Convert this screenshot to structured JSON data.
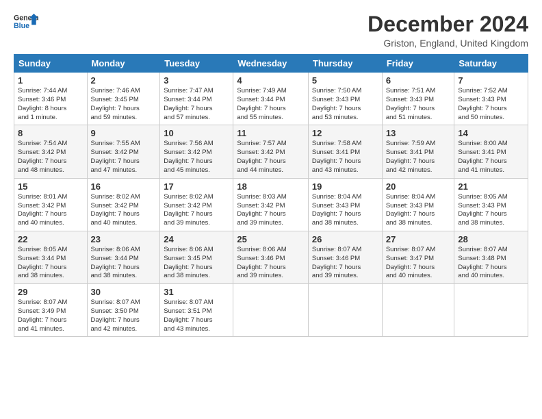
{
  "logo": {
    "line1": "General",
    "line2": "Blue"
  },
  "title": "December 2024",
  "subtitle": "Griston, England, United Kingdom",
  "headers": [
    "Sunday",
    "Monday",
    "Tuesday",
    "Wednesday",
    "Thursday",
    "Friday",
    "Saturday"
  ],
  "weeks": [
    [
      {
        "day": "1",
        "sunrise": "7:44 AM",
        "sunset": "3:46 PM",
        "daylight": "8 hours and 1 minute."
      },
      {
        "day": "2",
        "sunrise": "7:46 AM",
        "sunset": "3:45 PM",
        "daylight": "7 hours and 59 minutes."
      },
      {
        "day": "3",
        "sunrise": "7:47 AM",
        "sunset": "3:44 PM",
        "daylight": "7 hours and 57 minutes."
      },
      {
        "day": "4",
        "sunrise": "7:49 AM",
        "sunset": "3:44 PM",
        "daylight": "7 hours and 55 minutes."
      },
      {
        "day": "5",
        "sunrise": "7:50 AM",
        "sunset": "3:43 PM",
        "daylight": "7 hours and 53 minutes."
      },
      {
        "day": "6",
        "sunrise": "7:51 AM",
        "sunset": "3:43 PM",
        "daylight": "7 hours and 51 minutes."
      },
      {
        "day": "7",
        "sunrise": "7:52 AM",
        "sunset": "3:43 PM",
        "daylight": "7 hours and 50 minutes."
      }
    ],
    [
      {
        "day": "8",
        "sunrise": "7:54 AM",
        "sunset": "3:42 PM",
        "daylight": "7 hours and 48 minutes."
      },
      {
        "day": "9",
        "sunrise": "7:55 AM",
        "sunset": "3:42 PM",
        "daylight": "7 hours and 47 minutes."
      },
      {
        "day": "10",
        "sunrise": "7:56 AM",
        "sunset": "3:42 PM",
        "daylight": "7 hours and 45 minutes."
      },
      {
        "day": "11",
        "sunrise": "7:57 AM",
        "sunset": "3:42 PM",
        "daylight": "7 hours and 44 minutes."
      },
      {
        "day": "12",
        "sunrise": "7:58 AM",
        "sunset": "3:41 PM",
        "daylight": "7 hours and 43 minutes."
      },
      {
        "day": "13",
        "sunrise": "7:59 AM",
        "sunset": "3:41 PM",
        "daylight": "7 hours and 42 minutes."
      },
      {
        "day": "14",
        "sunrise": "8:00 AM",
        "sunset": "3:41 PM",
        "daylight": "7 hours and 41 minutes."
      }
    ],
    [
      {
        "day": "15",
        "sunrise": "8:01 AM",
        "sunset": "3:42 PM",
        "daylight": "7 hours and 40 minutes."
      },
      {
        "day": "16",
        "sunrise": "8:02 AM",
        "sunset": "3:42 PM",
        "daylight": "7 hours and 40 minutes."
      },
      {
        "day": "17",
        "sunrise": "8:02 AM",
        "sunset": "3:42 PM",
        "daylight": "7 hours and 39 minutes."
      },
      {
        "day": "18",
        "sunrise": "8:03 AM",
        "sunset": "3:42 PM",
        "daylight": "7 hours and 39 minutes."
      },
      {
        "day": "19",
        "sunrise": "8:04 AM",
        "sunset": "3:43 PM",
        "daylight": "7 hours and 38 minutes."
      },
      {
        "day": "20",
        "sunrise": "8:04 AM",
        "sunset": "3:43 PM",
        "daylight": "7 hours and 38 minutes."
      },
      {
        "day": "21",
        "sunrise": "8:05 AM",
        "sunset": "3:43 PM",
        "daylight": "7 hours and 38 minutes."
      }
    ],
    [
      {
        "day": "22",
        "sunrise": "8:05 AM",
        "sunset": "3:44 PM",
        "daylight": "7 hours and 38 minutes."
      },
      {
        "day": "23",
        "sunrise": "8:06 AM",
        "sunset": "3:44 PM",
        "daylight": "7 hours and 38 minutes."
      },
      {
        "day": "24",
        "sunrise": "8:06 AM",
        "sunset": "3:45 PM",
        "daylight": "7 hours and 38 minutes."
      },
      {
        "day": "25",
        "sunrise": "8:06 AM",
        "sunset": "3:46 PM",
        "daylight": "7 hours and 39 minutes."
      },
      {
        "day": "26",
        "sunrise": "8:07 AM",
        "sunset": "3:46 PM",
        "daylight": "7 hours and 39 minutes."
      },
      {
        "day": "27",
        "sunrise": "8:07 AM",
        "sunset": "3:47 PM",
        "daylight": "7 hours and 40 minutes."
      },
      {
        "day": "28",
        "sunrise": "8:07 AM",
        "sunset": "3:48 PM",
        "daylight": "7 hours and 40 minutes."
      }
    ],
    [
      {
        "day": "29",
        "sunrise": "8:07 AM",
        "sunset": "3:49 PM",
        "daylight": "7 hours and 41 minutes."
      },
      {
        "day": "30",
        "sunrise": "8:07 AM",
        "sunset": "3:50 PM",
        "daylight": "7 hours and 42 minutes."
      },
      {
        "day": "31",
        "sunrise": "8:07 AM",
        "sunset": "3:51 PM",
        "daylight": "7 hours and 43 minutes."
      },
      null,
      null,
      null,
      null
    ]
  ],
  "sunrise_label": "Sunrise:",
  "sunset_label": "Sunset:",
  "daylight_label": "Daylight:"
}
